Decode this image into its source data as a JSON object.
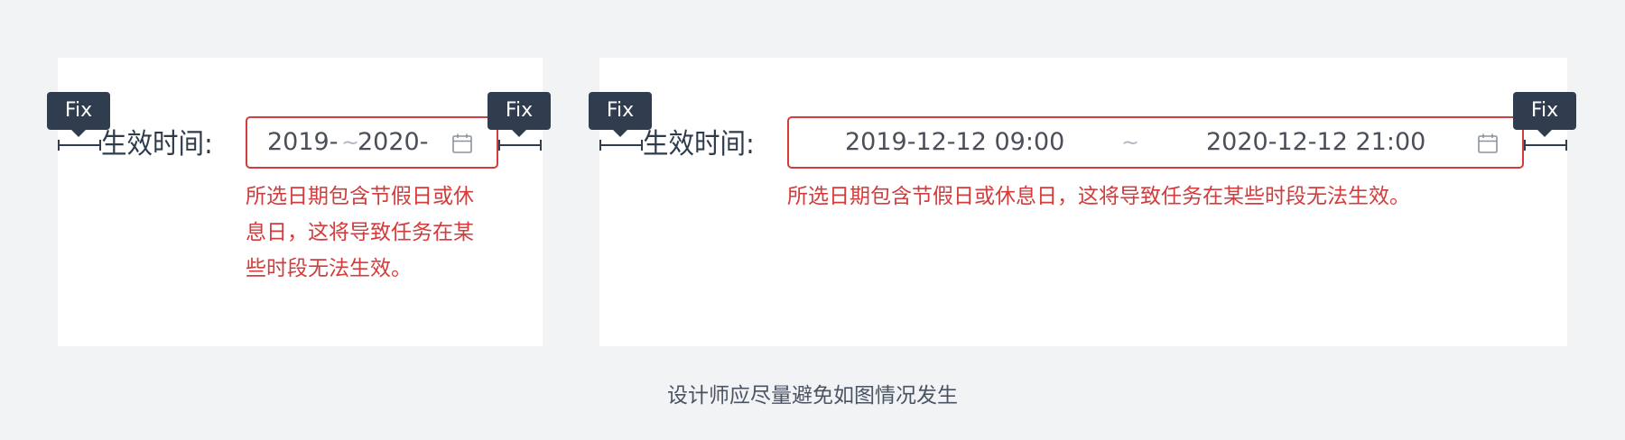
{
  "left_example": {
    "field_label": "生效时间:",
    "start_value": "2019-",
    "separator": "~",
    "end_value": "2020-",
    "error_lines": [
      "所选日期包含节假日或休",
      "息日，这将导致任务在某",
      "些时段无法生效。"
    ],
    "fix_badges": [
      "Fix",
      "Fix"
    ]
  },
  "right_example": {
    "field_label": "生效时间:",
    "start_value": "2019-12-12 09:00",
    "separator": "~",
    "end_value": "2020-12-12 21:00",
    "error_text": "所选日期包含节假日或休息日，这将导致任务在某些时段无法生效。",
    "fix_badges": [
      "Fix",
      "Fix"
    ]
  },
  "caption": "设计师应尽量避免如图情况发生",
  "colors": {
    "background": "#f2f3f5",
    "panel": "#ffffff",
    "error": "#d23c3c",
    "badge": "#2f3d4e",
    "label_text": "#2e3b4b"
  },
  "icons": [
    "calendar-icon"
  ]
}
